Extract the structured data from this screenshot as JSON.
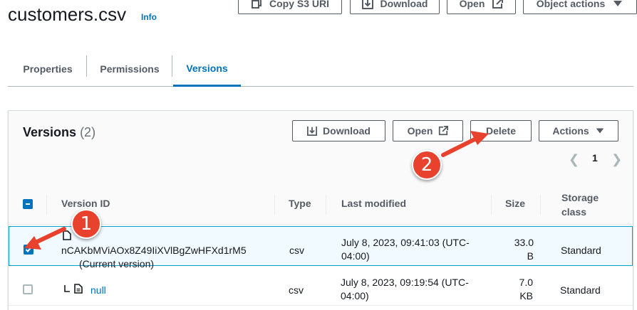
{
  "header": {
    "title": "customers.csv",
    "info_label": "Info",
    "buttons": {
      "copy_s3_uri": "Copy S3 URI",
      "download": "Download",
      "open": "Open",
      "object_actions": "Object actions"
    }
  },
  "tabs": [
    {
      "label": "Properties",
      "active": false
    },
    {
      "label": "Permissions",
      "active": false
    },
    {
      "label": "Versions",
      "active": true
    }
  ],
  "versions_panel": {
    "title": "Versions",
    "count": "(2)",
    "buttons": {
      "download": "Download",
      "open": "Open",
      "delete": "Delete",
      "actions": "Actions"
    },
    "pagination": {
      "current_page": "1"
    },
    "columns": {
      "version_id": "Version ID",
      "type": "Type",
      "last_modified": "Last modified",
      "size": "Size",
      "storage_class_line1": "Storage",
      "storage_class_line2": "class"
    },
    "rows": [
      {
        "selected": true,
        "version_id": "nCAKbMViAOx8Z49IiXVlBgZwHFXd1rM5",
        "version_note": "(Current version)",
        "type": "csv",
        "last_modified_line1": "July 8, 2023, 09:41:03 (UTC-",
        "last_modified_line2": "04:00)",
        "size_line1": "33.0",
        "size_line2": "B",
        "storage_class": "Standard"
      },
      {
        "selected": false,
        "version_id": "null",
        "type": "csv",
        "last_modified_line1": "July 8, 2023, 09:19:54 (UTC-",
        "last_modified_line2": "04:00)",
        "size_line1": "7.0",
        "size_line2": "KB",
        "storage_class": "Standard"
      }
    ]
  },
  "annotations": {
    "step1": "1",
    "step2": "2",
    "color": "#e8412e"
  },
  "colors": {
    "accent": "#0073bb",
    "button_border": "#545b64",
    "selected_row_bg": "#f1faff",
    "selected_row_border": "#00a1c9"
  }
}
